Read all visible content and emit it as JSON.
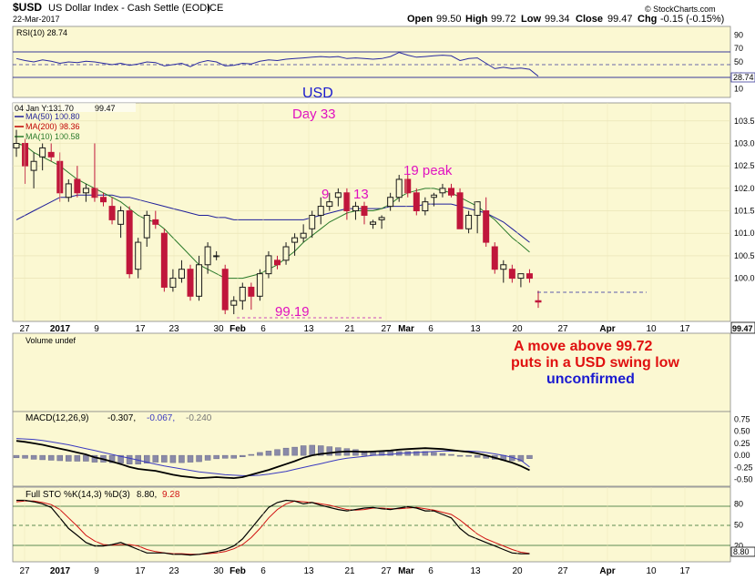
{
  "header": {
    "symbol": "$USD",
    "name": "US Dollar Index - Cash Settle (EOD)",
    "exchange": "ICE",
    "date": "22-Mar-2017",
    "open_label": "Open",
    "open": "99.50",
    "high_label": "High",
    "high": "99.72",
    "low_label": "Low",
    "low": "99.34",
    "close_label": "Close",
    "close": "99.47",
    "chg_label": "Chg",
    "chg": "-0.15 (-0.15%)",
    "watermark": "© StockCharts.com"
  },
  "rsi": {
    "label": "RSI(10) 28.74",
    "ticks": [
      "90",
      "70",
      "50",
      "30",
      "10"
    ],
    "last_badge": "28.74"
  },
  "price": {
    "info_line": "04 Jan Y:131.70",
    "info_value": "99.47",
    "legend": [
      {
        "text": "MA(50) 100.80",
        "color": "#1f1f9a"
      },
      {
        "text": "MA(200) 98.36",
        "color": "#c00000"
      },
      {
        "text": "MA(10) 100.58",
        "color": "#2a7a2a"
      }
    ],
    "ticks": [
      "103.5",
      "103.0",
      "102.5",
      "102.0",
      "101.5",
      "101.0",
      "100.5",
      "100.0"
    ],
    "last_badge": "99.47",
    "annotations": {
      "usd": "USD",
      "day": "Day 33",
      "nine": "9",
      "thirteen": "13",
      "peak": "19 peak",
      "support": "99.19"
    }
  },
  "x_axis": {
    "labels": [
      "27",
      "2017",
      "9",
      "17",
      "23",
      "30",
      "Feb",
      "6",
      "13",
      "21",
      "27",
      "Mar",
      "6",
      "13",
      "20",
      "27",
      "Apr",
      "10",
      "17"
    ]
  },
  "volume": {
    "label": "Volume undef",
    "note_line1": "A move above 99.72",
    "note_line2": "puts in a USD swing low",
    "note_line3": "unconfirmed"
  },
  "macd": {
    "label_prefix": "MACD(12,26,9)",
    "v1": "-0.307,",
    "v2": "-0.067,",
    "v3": "-0.240",
    "ticks": [
      "0.75",
      "0.50",
      "0.25",
      "0.00",
      "-0.25",
      "-0.50"
    ]
  },
  "sto": {
    "label_prefix": "Full STO %K(14,3) %D(3)",
    "k": "8.80,",
    "d": "9.28",
    "ticks": [
      "80",
      "50",
      "20"
    ],
    "last_badge": "8.80"
  },
  "colors": {
    "panel_bg": "#fbf8d2",
    "up": "#1a1a1a",
    "down": "#c0163b",
    "ma50": "#1f1f9a",
    "ma10": "#2a7a2a",
    "annot_magenta": "#e010c0",
    "annot_red": "#e01010",
    "annot_blue": "#1a1ad0"
  },
  "chart_data": {
    "type": "candlestick",
    "title": "$USD US Dollar Index - Cash Settle (EOD) ICE",
    "ylim": [
      99.1,
      103.8
    ],
    "candles": [
      {
        "o": 102.9,
        "h": 103.3,
        "l": 102.7,
        "c": 103.0
      },
      {
        "o": 103.0,
        "h": 103.1,
        "l": 102.1,
        "c": 102.5
      },
      {
        "o": 102.4,
        "h": 102.8,
        "l": 102.0,
        "c": 102.6
      },
      {
        "o": 102.7,
        "h": 103.0,
        "l": 102.4,
        "c": 102.9
      },
      {
        "o": 102.8,
        "h": 103.0,
        "l": 102.6,
        "c": 102.7
      },
      {
        "o": 102.6,
        "h": 102.8,
        "l": 101.7,
        "c": 101.9
      },
      {
        "o": 101.8,
        "h": 102.2,
        "l": 101.7,
        "c": 102.1
      },
      {
        "o": 102.2,
        "h": 102.5,
        "l": 101.8,
        "c": 101.9
      },
      {
        "o": 101.9,
        "h": 102.1,
        "l": 101.7,
        "c": 102.0
      },
      {
        "o": 102.0,
        "h": 103.0,
        "l": 101.7,
        "c": 101.8
      },
      {
        "o": 101.8,
        "h": 101.9,
        "l": 101.6,
        "c": 101.7
      },
      {
        "o": 101.6,
        "h": 101.8,
        "l": 101.2,
        "c": 101.3
      },
      {
        "o": 101.2,
        "h": 101.6,
        "l": 100.9,
        "c": 101.5
      },
      {
        "o": 101.5,
        "h": 101.6,
        "l": 100.0,
        "c": 100.1
      },
      {
        "o": 100.2,
        "h": 100.9,
        "l": 100.0,
        "c": 100.8
      },
      {
        "o": 100.9,
        "h": 101.5,
        "l": 100.7,
        "c": 101.4
      },
      {
        "o": 101.3,
        "h": 101.5,
        "l": 101.1,
        "c": 101.2
      },
      {
        "o": 101.0,
        "h": 101.1,
        "l": 99.7,
        "c": 99.8
      },
      {
        "o": 99.8,
        "h": 100.2,
        "l": 99.7,
        "c": 100.0
      },
      {
        "o": 100.0,
        "h": 100.4,
        "l": 99.9,
        "c": 100.2
      },
      {
        "o": 100.2,
        "h": 100.3,
        "l": 99.5,
        "c": 99.6
      },
      {
        "o": 99.6,
        "h": 100.5,
        "l": 99.5,
        "c": 100.3
      },
      {
        "o": 100.3,
        "h": 100.8,
        "l": 100.1,
        "c": 100.7
      },
      {
        "o": 100.5,
        "h": 100.6,
        "l": 100.4,
        "c": 100.5
      },
      {
        "o": 100.2,
        "h": 100.3,
        "l": 99.2,
        "c": 99.3
      },
      {
        "o": 99.4,
        "h": 99.6,
        "l": 99.2,
        "c": 99.5
      },
      {
        "o": 99.5,
        "h": 99.9,
        "l": 99.3,
        "c": 99.8
      },
      {
        "o": 99.8,
        "h": 99.9,
        "l": 99.3,
        "c": 99.6
      },
      {
        "o": 99.6,
        "h": 100.2,
        "l": 99.5,
        "c": 100.1
      },
      {
        "o": 100.1,
        "h": 100.6,
        "l": 100.0,
        "c": 100.5
      },
      {
        "o": 100.4,
        "h": 100.5,
        "l": 100.2,
        "c": 100.3
      },
      {
        "o": 100.4,
        "h": 100.8,
        "l": 100.3,
        "c": 100.7
      },
      {
        "o": 100.8,
        "h": 101.0,
        "l": 100.5,
        "c": 100.9
      },
      {
        "o": 100.9,
        "h": 101.2,
        "l": 100.8,
        "c": 101.0
      },
      {
        "o": 101.1,
        "h": 101.5,
        "l": 100.9,
        "c": 101.4
      },
      {
        "o": 101.4,
        "h": 101.8,
        "l": 101.2,
        "c": 101.6
      },
      {
        "o": 101.6,
        "h": 101.9,
        "l": 101.5,
        "c": 101.7
      },
      {
        "o": 101.8,
        "h": 102.0,
        "l": 101.6,
        "c": 101.9
      },
      {
        "o": 101.9,
        "h": 102.0,
        "l": 101.3,
        "c": 101.5
      },
      {
        "o": 101.5,
        "h": 101.7,
        "l": 101.3,
        "c": 101.6
      },
      {
        "o": 101.6,
        "h": 101.7,
        "l": 101.2,
        "c": 101.4
      },
      {
        "o": 101.2,
        "h": 101.3,
        "l": 101.1,
        "c": 101.25
      },
      {
        "o": 101.3,
        "h": 101.4,
        "l": 101.1,
        "c": 101.35
      },
      {
        "o": 101.6,
        "h": 101.9,
        "l": 101.5,
        "c": 101.8
      },
      {
        "o": 101.8,
        "h": 102.3,
        "l": 101.7,
        "c": 102.2
      },
      {
        "o": 102.2,
        "h": 102.3,
        "l": 101.8,
        "c": 101.9
      },
      {
        "o": 101.9,
        "h": 102.0,
        "l": 101.4,
        "c": 101.5
      },
      {
        "o": 101.5,
        "h": 101.8,
        "l": 101.4,
        "c": 101.7
      },
      {
        "o": 101.8,
        "h": 101.9,
        "l": 101.6,
        "c": 101.85
      },
      {
        "o": 101.9,
        "h": 102.1,
        "l": 101.8,
        "c": 102.0
      },
      {
        "o": 102.0,
        "h": 102.1,
        "l": 101.8,
        "c": 101.85
      },
      {
        "o": 101.9,
        "h": 102.0,
        "l": 101.1,
        "c": 101.1
      },
      {
        "o": 101.1,
        "h": 101.5,
        "l": 101.0,
        "c": 101.4
      },
      {
        "o": 101.4,
        "h": 101.7,
        "l": 101.0,
        "c": 101.7
      },
      {
        "o": 101.5,
        "h": 101.8,
        "l": 100.7,
        "c": 100.8
      },
      {
        "o": 100.7,
        "h": 100.8,
        "l": 100.1,
        "c": 100.2
      },
      {
        "o": 100.2,
        "h": 100.4,
        "l": 99.9,
        "c": 100.3
      },
      {
        "o": 100.2,
        "h": 100.3,
        "l": 99.9,
        "c": 100.0
      },
      {
        "o": 100.0,
        "h": 100.1,
        "l": 99.8,
        "c": 100.1
      },
      {
        "o": 100.1,
        "h": 100.2,
        "l": 99.9,
        "c": 100.0
      },
      {
        "o": 99.5,
        "h": 99.72,
        "l": 99.34,
        "c": 99.47
      }
    ],
    "ma50_series": [
      101.3,
      101.4,
      101.5,
      101.6,
      101.7,
      101.8,
      101.8,
      101.85,
      101.85,
      101.85,
      101.85,
      101.85,
      101.8,
      101.8,
      101.75,
      101.7,
      101.65,
      101.6,
      101.55,
      101.5,
      101.45,
      101.4,
      101.4,
      101.35,
      101.35,
      101.3,
      101.3,
      101.3,
      101.3,
      101.3,
      101.3,
      101.3,
      101.3,
      101.3,
      101.35,
      101.4,
      101.45,
      101.5,
      101.55,
      101.55,
      101.55,
      101.55,
      101.55,
      101.6,
      101.6,
      101.6,
      101.6,
      101.65,
      101.65,
      101.65,
      101.65,
      101.6,
      101.55,
      101.5,
      101.45,
      101.35,
      101.25,
      101.1,
      100.95,
      100.8
    ],
    "ma10_series": [
      103.0,
      102.95,
      102.8,
      102.7,
      102.6,
      102.5,
      102.35,
      102.2,
      102.1,
      102.0,
      101.9,
      101.8,
      101.7,
      101.55,
      101.4,
      101.3,
      101.25,
      101.1,
      100.9,
      100.7,
      100.5,
      100.3,
      100.2,
      100.1,
      100.0,
      100.0,
      100.0,
      100.05,
      100.1,
      100.2,
      100.3,
      100.45,
      100.6,
      100.8,
      100.95,
      101.1,
      101.25,
      101.35,
      101.45,
      101.5,
      101.5,
      101.5,
      101.55,
      101.65,
      101.8,
      101.9,
      101.95,
      102.0,
      102.0,
      101.95,
      101.9,
      101.8,
      101.7,
      101.6,
      101.45,
      101.3,
      101.1,
      100.9,
      100.75,
      100.58
    ],
    "rsi_series": [
      55,
      52,
      50,
      53,
      51,
      48,
      50,
      49,
      51,
      50,
      48,
      46,
      48,
      45,
      47,
      50,
      49,
      44,
      46,
      48,
      43,
      49,
      52,
      50,
      44,
      45,
      48,
      47,
      51,
      53,
      52,
      54,
      55,
      56,
      57,
      58,
      57,
      58,
      55,
      56,
      55,
      54,
      55,
      58,
      64,
      60,
      57,
      58,
      59,
      60,
      59,
      52,
      55,
      56,
      48,
      40,
      42,
      40,
      41,
      39,
      28.74
    ],
    "macd_series": [
      0.3,
      0.28,
      0.25,
      0.22,
      0.18,
      0.14,
      0.1,
      0.06,
      0.02,
      -0.04,
      -0.08,
      -0.13,
      -0.18,
      -0.24,
      -0.28,
      -0.3,
      -0.32,
      -0.36,
      -0.4,
      -0.43,
      -0.45,
      -0.47,
      -0.46,
      -0.45,
      -0.46,
      -0.47,
      -0.45,
      -0.4,
      -0.35,
      -0.3,
      -0.24,
      -0.18,
      -0.12,
      -0.05,
      0.0,
      0.03,
      0.05,
      0.07,
      0.08,
      0.08,
      0.07,
      0.08,
      0.09,
      0.1,
      0.12,
      0.13,
      0.14,
      0.15,
      0.14,
      0.13,
      0.11,
      0.09,
      0.07,
      0.04,
      0.0,
      -0.05,
      -0.1,
      -0.15,
      -0.22,
      -0.307
    ],
    "macd_signal_series": [
      0.35,
      0.34,
      0.33,
      0.31,
      0.28,
      0.25,
      0.22,
      0.18,
      0.14,
      0.1,
      0.06,
      0.02,
      -0.02,
      -0.06,
      -0.1,
      -0.14,
      -0.18,
      -0.22,
      -0.25,
      -0.28,
      -0.31,
      -0.34,
      -0.36,
      -0.38,
      -0.4,
      -0.41,
      -0.42,
      -0.42,
      -0.41,
      -0.39,
      -0.36,
      -0.33,
      -0.29,
      -0.25,
      -0.21,
      -0.17,
      -0.13,
      -0.09,
      -0.06,
      -0.04,
      -0.02,
      0.0,
      0.01,
      0.02,
      0.04,
      0.05,
      0.06,
      0.07,
      0.08,
      0.09,
      0.09,
      0.09,
      0.09,
      0.08,
      0.06,
      0.03,
      0.0,
      -0.04,
      -0.1,
      -0.24
    ],
    "sto_k_series": [
      85,
      85,
      83,
      80,
      75,
      60,
      45,
      35,
      25,
      20,
      20,
      22,
      25,
      20,
      15,
      10,
      10,
      10,
      8,
      8,
      7,
      8,
      10,
      12,
      15,
      20,
      30,
      45,
      60,
      75,
      82,
      85,
      84,
      80,
      82,
      78,
      75,
      72,
      70,
      72,
      74,
      75,
      73,
      72,
      74,
      76,
      74,
      70,
      70,
      65,
      60,
      45,
      35,
      30,
      25,
      20,
      15,
      10,
      9,
      8.8
    ],
    "sto_d_series": [
      83,
      84,
      84,
      82,
      79,
      72,
      60,
      48,
      35,
      27,
      22,
      21,
      22,
      22,
      20,
      15,
      12,
      10,
      9,
      9,
      8,
      8,
      9,
      10,
      12,
      16,
      22,
      32,
      45,
      60,
      72,
      80,
      84,
      83,
      82,
      80,
      78,
      75,
      72,
      71,
      72,
      74,
      74,
      73,
      73,
      74,
      75,
      73,
      71,
      68,
      65,
      57,
      47,
      37,
      30,
      25,
      20,
      15,
      11,
      9.28
    ]
  }
}
